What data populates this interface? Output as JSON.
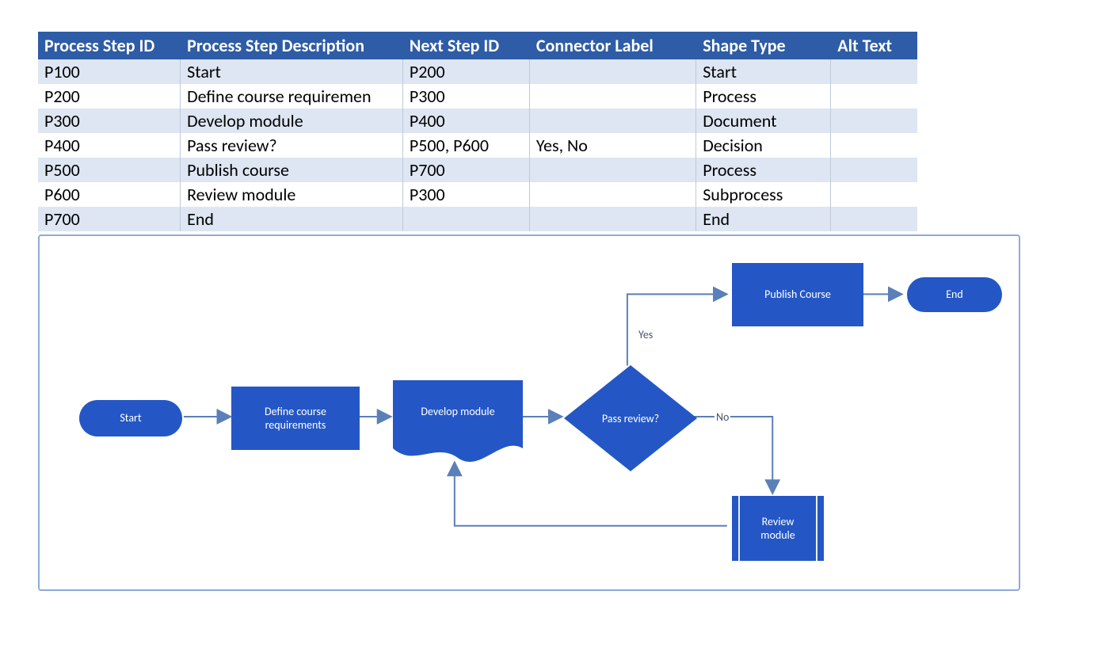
{
  "table": {
    "headers": [
      "Process Step ID",
      "Process Step Description",
      "Next Step ID",
      "Connector Label",
      "Shape Type",
      "Alt Text"
    ],
    "rows": [
      {
        "id": "P100",
        "desc": "Start",
        "next": "P200",
        "conn": "",
        "shape": "Start",
        "alt": ""
      },
      {
        "id": "P200",
        "desc": "Define course requiremen",
        "next": "P300",
        "conn": "",
        "shape": "Process",
        "alt": ""
      },
      {
        "id": "P300",
        "desc": "Develop module",
        "next": "P400",
        "conn": "",
        "shape": "Document",
        "alt": ""
      },
      {
        "id": "P400",
        "desc": "Pass review?",
        "next": "P500, P600",
        "conn": "Yes, No",
        "shape": "Decision",
        "alt": ""
      },
      {
        "id": "P500",
        "desc": "Publish course",
        "next": "P700",
        "conn": "",
        "shape": "Process",
        "alt": ""
      },
      {
        "id": "P600",
        "desc": "Review module",
        "next": "P300",
        "conn": "",
        "shape": "Subprocess",
        "alt": ""
      },
      {
        "id": "P700",
        "desc": "End",
        "next": "",
        "conn": "",
        "shape": "End",
        "alt": ""
      }
    ]
  },
  "diagram": {
    "shapes": {
      "start": {
        "label": "Start"
      },
      "define": {
        "label": "Define course\nrequirements"
      },
      "develop": {
        "label": "Develop module"
      },
      "decision": {
        "label": "Pass review?"
      },
      "publish": {
        "label": "Publish Course"
      },
      "end": {
        "label": "End"
      },
      "review": {
        "label": "Review\nmodule"
      }
    },
    "labels": {
      "yes": "Yes",
      "no": "No"
    }
  },
  "chart_data": {
    "type": "flowchart",
    "nodes": [
      {
        "id": "P100",
        "label": "Start",
        "shape": "terminator"
      },
      {
        "id": "P200",
        "label": "Define course requirements",
        "shape": "process"
      },
      {
        "id": "P300",
        "label": "Develop module",
        "shape": "document"
      },
      {
        "id": "P400",
        "label": "Pass review?",
        "shape": "decision"
      },
      {
        "id": "P500",
        "label": "Publish Course",
        "shape": "process"
      },
      {
        "id": "P600",
        "label": "Review module",
        "shape": "subprocess"
      },
      {
        "id": "P700",
        "label": "End",
        "shape": "terminator"
      }
    ],
    "edges": [
      {
        "from": "P100",
        "to": "P200",
        "label": ""
      },
      {
        "from": "P200",
        "to": "P300",
        "label": ""
      },
      {
        "from": "P300",
        "to": "P400",
        "label": ""
      },
      {
        "from": "P400",
        "to": "P500",
        "label": "Yes"
      },
      {
        "from": "P400",
        "to": "P600",
        "label": "No"
      },
      {
        "from": "P500",
        "to": "P700",
        "label": ""
      },
      {
        "from": "P600",
        "to": "P300",
        "label": ""
      }
    ]
  }
}
